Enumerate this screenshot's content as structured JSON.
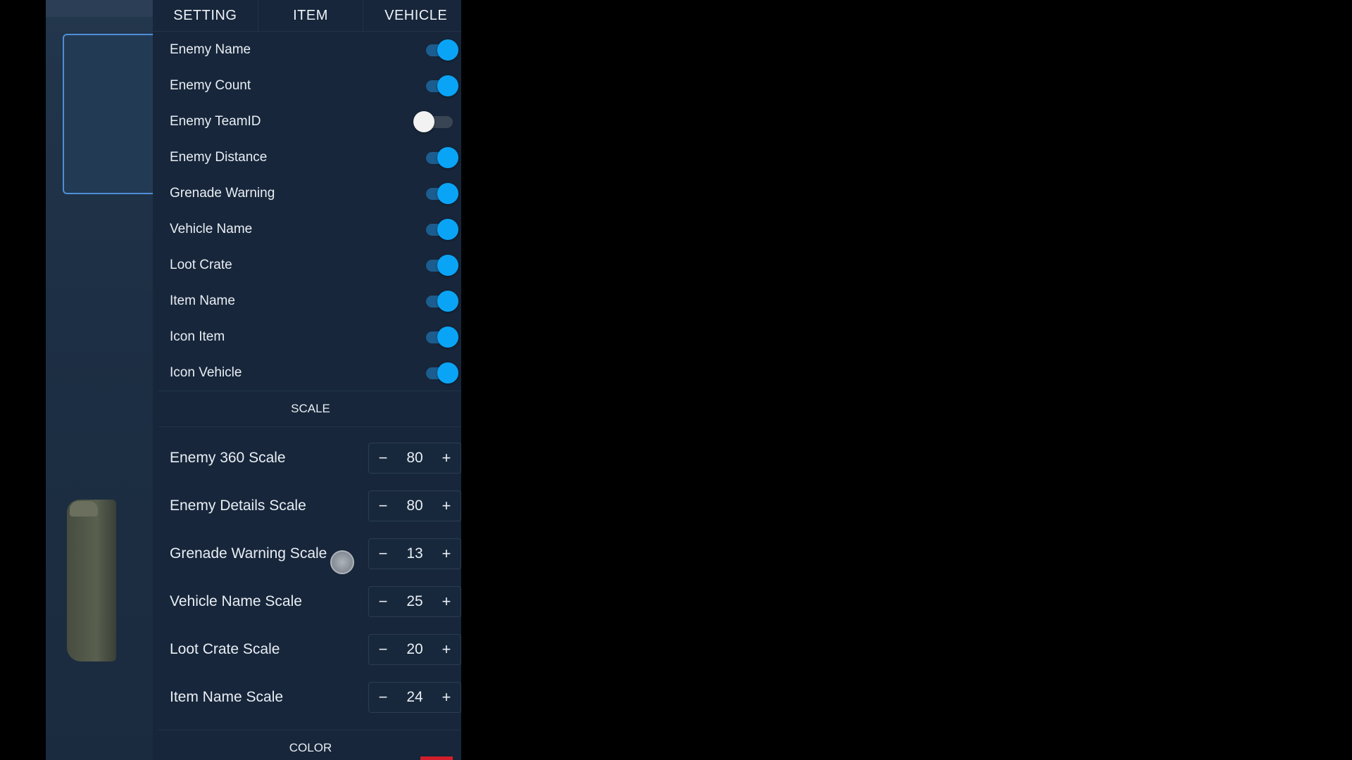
{
  "tabs": [
    "SETTING",
    "ITEM",
    "VEHICLE"
  ],
  "toggles": [
    {
      "label": "Enemy Name",
      "on": true
    },
    {
      "label": "Enemy Count",
      "on": true
    },
    {
      "label": "Enemy TeamID",
      "on": false
    },
    {
      "label": "Enemy Distance",
      "on": true
    },
    {
      "label": "Grenade Warning",
      "on": true
    },
    {
      "label": "Vehicle Name",
      "on": true
    },
    {
      "label": "Loot Crate",
      "on": true
    },
    {
      "label": "Item Name",
      "on": true
    },
    {
      "label": "Icon Item",
      "on": true
    },
    {
      "label": "Icon Vehicle",
      "on": true
    }
  ],
  "scale_header": "SCALE",
  "steppers": [
    {
      "label": "Enemy 360 Scale",
      "value": "80"
    },
    {
      "label": "Enemy Details Scale",
      "value": "80"
    },
    {
      "label": "Grenade Warning Scale",
      "value": "13"
    },
    {
      "label": "Vehicle Name Scale",
      "value": "25"
    },
    {
      "label": "Loot Crate Scale",
      "value": "20"
    },
    {
      "label": "Item Name Scale",
      "value": "24"
    }
  ],
  "stepper_minus": "−",
  "stepper_plus": "+",
  "color_header": "COLOR",
  "colors": {
    "accent": "#0aa4f6",
    "swatch": "#d21e2a"
  }
}
